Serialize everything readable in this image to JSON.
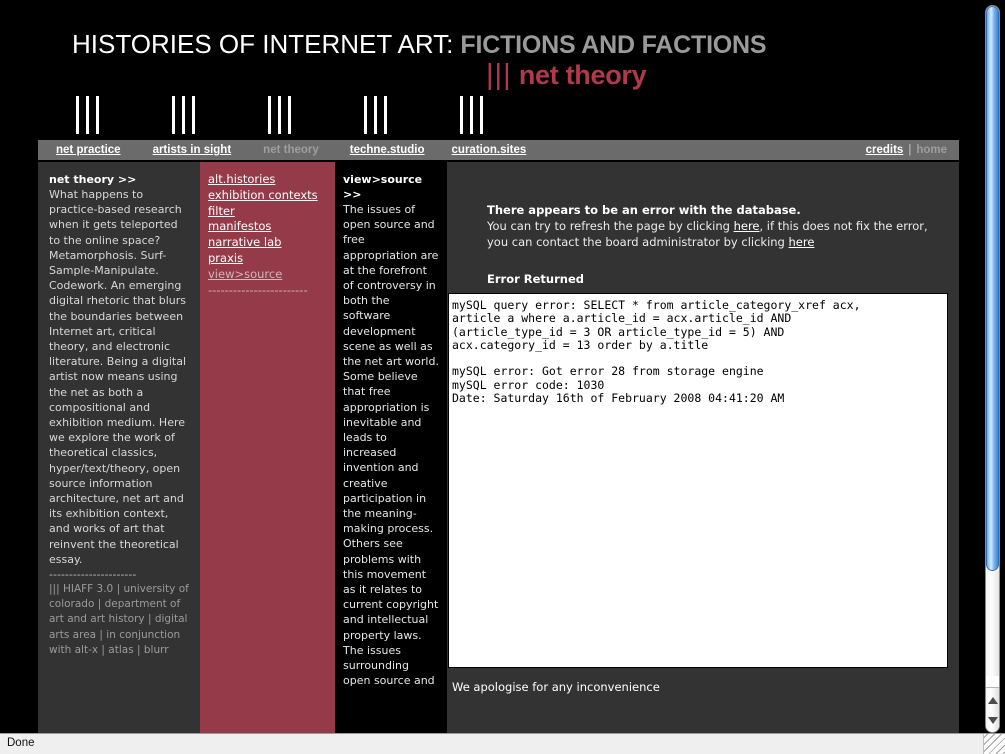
{
  "masthead": {
    "title_main": "HISTORIES OF INTERNET ART:",
    "title_sub": "FICTIONS AND FACTIONS",
    "section_tally": "|||",
    "section_name": "net theory",
    "tally_icon": "tally-three-marks"
  },
  "nav": {
    "items": [
      {
        "label": "net practice",
        "current": false
      },
      {
        "label": "artists in sight",
        "current": false
      },
      {
        "label": "net theory",
        "current": true
      },
      {
        "label": "techne.studio",
        "current": false
      },
      {
        "label": "curation.sites",
        "current": false
      }
    ],
    "utility": [
      {
        "label": "credits",
        "current": false
      },
      {
        "label": "home",
        "current": true
      }
    ],
    "separator": "|"
  },
  "intro": {
    "heading": "net theory >>",
    "body": "What happens to practice-based research when it gets teleported to the online space? Metamorphosis. Surf-Sample-Manipulate. Codework. An emerging digital rhetoric that blurs the boundaries between Internet art, critical theory, and electronic literature. Being a digital artist now means using the net as both a compositional and exhibition medium. Here we explore the work of theoretical classics, hyper/text/theory, open source information architecture, net art and its exhibition context, and works of art that reinvent the theoretical essay.",
    "rule": "----------------------",
    "credit": "||| HIAFF 3.0 | university of colorado | department of art and art history | digital arts area | in conjunction with alt-x | atlas | blurr"
  },
  "links": {
    "items": [
      {
        "label": "alt.histories",
        "current": false
      },
      {
        "label": "exhibition contexts",
        "current": false
      },
      {
        "label": "filter",
        "current": false
      },
      {
        "label": "manifestos",
        "current": false
      },
      {
        "label": "narrative lab",
        "current": false
      },
      {
        "label": "praxis",
        "current": false
      },
      {
        "label": "view>source",
        "current": true
      }
    ],
    "rule": "------------------------"
  },
  "description": {
    "heading": "view>source >>",
    "body": "The issues of open source and free appropriation are at the forefront of controversy in both the software development scene as well as the net art world. Some believe that free appropriation is inevitable and leads to increased invention and creative participation in the meaning-making process. Others see problems with this movement as it relates to current copyright and intellectual property laws. The issues surrounding open source and"
  },
  "error": {
    "headline": "There appears to be an error with the database.",
    "line1_before": "You can try to refresh the page by clicking ",
    "line1_link": "here",
    "line1_after": ", if this does not fix the error, you can contact the board administrator by clicking ",
    "line2_link": "here",
    "returned_label": "Error Returned",
    "query_text": "mySQL query error: SELECT * from article_category_xref acx,\narticle a where a.article_id = acx.article_id AND\n(article_type_id = 3 OR article_type_id = 5) AND\nacx.category_id = 13 order by a.title\n\nmySQL error: Got error 28 from storage engine\nmySQL error code: 1030\nDate: Saturday 16th of February 2008 04:41:20 AM",
    "apology": "We apologise for any inconvenience"
  },
  "browser": {
    "status": "Done",
    "scrollbar_name": "vertical-scrollbar",
    "scroll_up_icon": "triangle-up-icon",
    "scroll_down_icon": "triangle-down-icon"
  },
  "colors": {
    "accent_red": "#943a48",
    "panel_gray": "#333333",
    "nav_gray": "#6b6b6b",
    "heading_red": "#b03a4b"
  }
}
